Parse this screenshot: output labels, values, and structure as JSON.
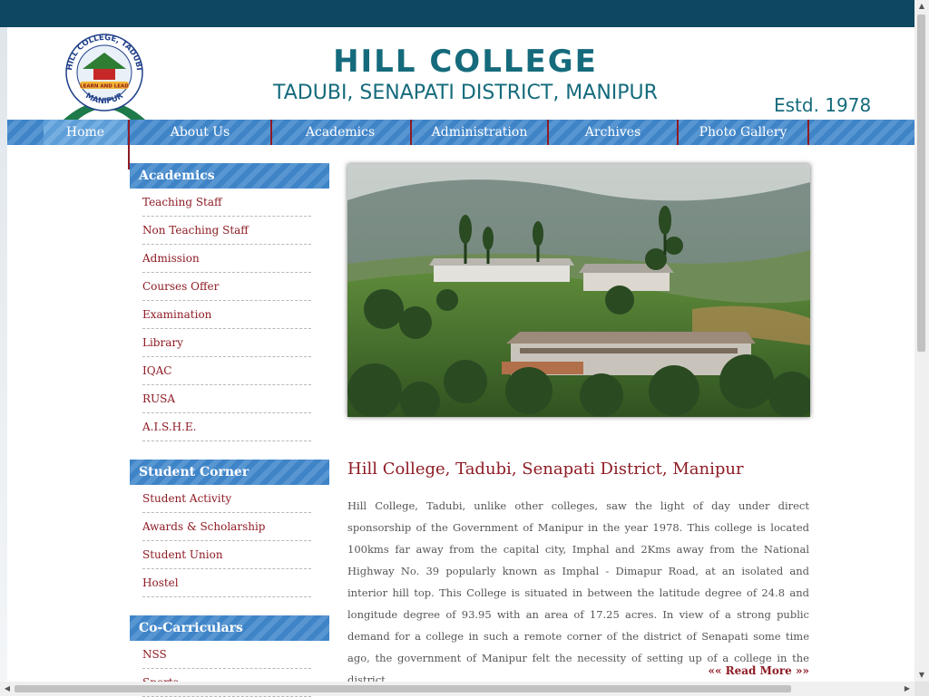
{
  "header": {
    "logo_text_top": "HILL COLLEGE, TADUBI",
    "logo_motto": "LEARN AND LEAD",
    "logo_text_bottom": "MANIPUR",
    "title": "HILL COLLEGE",
    "subtitle": "TADUBI, SENAPATI DISTRICT, MANIPUR",
    "estd": "Estd. 1978"
  },
  "nav": {
    "items": [
      {
        "label": "Home",
        "active": true
      },
      {
        "label": "About Us"
      },
      {
        "label": "Academics"
      },
      {
        "label": "Administration"
      },
      {
        "label": "Archives"
      },
      {
        "label": "Photo Gallery"
      }
    ]
  },
  "sidebar": {
    "academics": {
      "title": "Academics",
      "items": [
        "Teaching Staff",
        "Non Teaching Staff",
        "Admission",
        "Courses Offer",
        "Examination",
        "Library",
        "IQAC",
        "RUSA",
        "A.I.S.H.E."
      ]
    },
    "student_corner": {
      "title": "Student Corner",
      "items": [
        "Student Activity",
        "Awards & Scholarship",
        "Student Union",
        "Hostel"
      ]
    },
    "co_curriculars": {
      "title": "Co-Carriculars",
      "items": [
        "NSS",
        "Sports"
      ]
    }
  },
  "main": {
    "heading": "Hill College, Tadubi, Senapati District, Manipur",
    "body": "Hill College, Tadubi, unlike other colleges, saw the light of day under direct sponsorship of the Government of Manipur in the year 1978. This college is located 100kms far away from the capital city, Imphal and 2Kms away from the National Highway No. 39 popularly known as Imphal - Dimapur Road, at an isolated and interior hill top. This College is situated in between the latitude degree of 24.8 and longitude degree of 93.95 with an area of 17.25 acres. In view of a strong public demand for a college in such a remote corner of the district of Senapati some time ago, the government of Manipur felt the necessity of setting up of a college in the district.",
    "read_more": "««  Read More  »»"
  },
  "colors": {
    "top_bar": "#0d4760",
    "nav_blue": "#3f84c7",
    "title_teal": "#156b7c",
    "link_maroon": "#8e1b24"
  }
}
